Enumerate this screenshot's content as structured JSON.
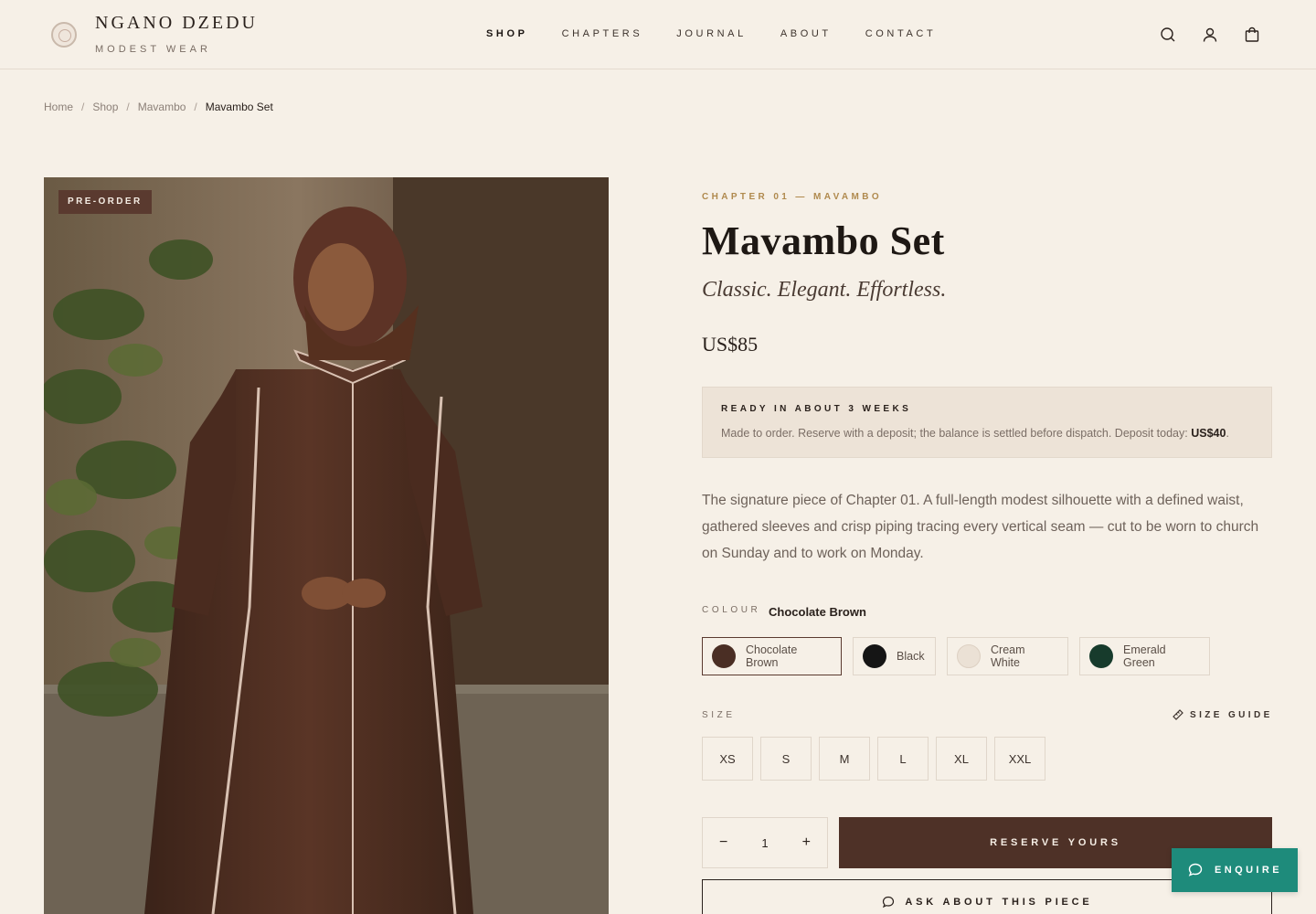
{
  "brand": {
    "name": "NGANO DZEDU",
    "tagline": "MODEST WEAR"
  },
  "nav": {
    "items": [
      "SHOP",
      "CHAPTERS",
      "JOURNAL",
      "ABOUT",
      "CONTACT"
    ],
    "active": "SHOP"
  },
  "header_icons": [
    "search-icon",
    "account-icon",
    "cart-icon"
  ],
  "breadcrumb": [
    "Home",
    "Shop",
    "Mavambo",
    "Mavambo Set"
  ],
  "product": {
    "badge": "PRE-ORDER",
    "eyebrow": "CHAPTER 01 — MAVAMBO",
    "title": "Mavambo Set",
    "subtitle": "Classic. Elegant. Effortless.",
    "price": "US$85",
    "notice": {
      "title": "READY IN ABOUT 3 WEEKS",
      "text": "Made to order. Reserve with a deposit; the balance is settled before dispatch. Deposit today:",
      "deposit": "US$40",
      "trailing": "."
    },
    "description": "The signature piece of Chapter 01. A full-length modest silhouette with a defined waist, gathered sleeves and crisp piping tracing every vertical seam — cut to be worn to church on Sunday and to work on Monday.",
    "colour": {
      "label": "COLOUR",
      "selected": "Chocolate Brown",
      "options": [
        {
          "name": "Chocolate Brown",
          "hex": "#4a2e24"
        },
        {
          "name": "Black",
          "hex": "#151515"
        },
        {
          "name": "Cream White",
          "hex": "#ebe1d5"
        },
        {
          "name": "Emerald Green",
          "hex": "#173b2c"
        }
      ]
    },
    "size": {
      "label": "SIZE",
      "guide": "SIZE GUIDE",
      "options": [
        "XS",
        "S",
        "M",
        "L",
        "XL",
        "XXL"
      ]
    },
    "quantity": {
      "value": "1",
      "minus": "−",
      "plus": "+"
    },
    "reserve_label": "RESERVE YOURS",
    "ask_label": "ASK ABOUT THIS PIECE"
  },
  "enquire_label": "ENQUIRE",
  "colors": {
    "background": "#f6f0e7",
    "accent_brown": "#4e3127",
    "accent_gold": "#b08a4e",
    "enquire_teal": "#1e8b7b"
  }
}
